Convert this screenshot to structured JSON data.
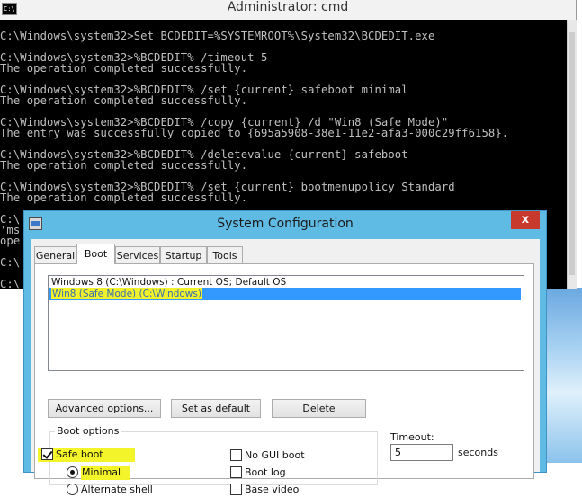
{
  "cmd": {
    "title": "Administrator: cmd",
    "icon_text": "C:\\",
    "lines": [
      "C:\\Windows\\system32>Set BCDEDIT=%SYSTEMROOT%\\System32\\BCDEDIT.exe",
      "",
      "C:\\Windows\\system32>%BCDEDIT% /timeout 5",
      "The operation completed successfully.",
      "",
      "C:\\Windows\\system32>%BCDEDIT% /set {current} safeboot minimal",
      "The operation completed successfully.",
      "",
      "C:\\Windows\\system32>%BCDEDIT% /copy {current} /d \"Win8 (Safe Mode)\"",
      "The entry was successfully copied to {695a5908-38e1-11e2-afa3-000c29ff6158}.",
      "",
      "C:\\Windows\\system32>%BCDEDIT% /deletevalue {current} safeboot",
      "The operation completed successfully.",
      "",
      "C:\\Windows\\system32>%BCDEDIT% /set {current} bootmenupolicy Standard",
      "The operation completed successfully.",
      "",
      "C:\\",
      "'ms",
      "ope",
      "",
      "C:\\",
      "",
      "C:\\"
    ]
  },
  "msconfig": {
    "title": "System Configuration",
    "close_glyph": "x",
    "tabs": [
      {
        "label": "General"
      },
      {
        "label": "Boot"
      },
      {
        "label": "Services"
      },
      {
        "label": "Startup"
      },
      {
        "label": "Tools"
      }
    ],
    "active_tab": "Boot",
    "os_entries": [
      {
        "label": "Windows 8 (C:\\Windows) : Current OS; Default OS",
        "selected": false
      },
      {
        "label": "Win8 (Safe Mode) (C:\\Windows)",
        "selected": true
      }
    ],
    "buttons": {
      "advanced": "Advanced options...",
      "set_default": "Set as default",
      "delete": "Delete"
    },
    "boot_options": {
      "legend": "Boot options",
      "safe_boot": {
        "label": "Safe boot",
        "checked": true
      },
      "minimal": {
        "label": "Minimal",
        "checked": true
      },
      "alternate_shell": {
        "label": "Alternate shell",
        "checked": false
      },
      "no_gui_boot": {
        "label": "No GUI boot",
        "checked": false
      },
      "boot_log": {
        "label": "Boot log",
        "checked": false
      },
      "base_video": {
        "label": "Base video",
        "checked": false
      }
    },
    "timeout": {
      "label": "Timeout:",
      "value": "5",
      "unit": "seconds"
    },
    "colors": {
      "highlight": "#f4f42a",
      "selection": "#3399ff",
      "close_button": "#c7382d",
      "dialog_frame": "#5fbbe4"
    }
  }
}
